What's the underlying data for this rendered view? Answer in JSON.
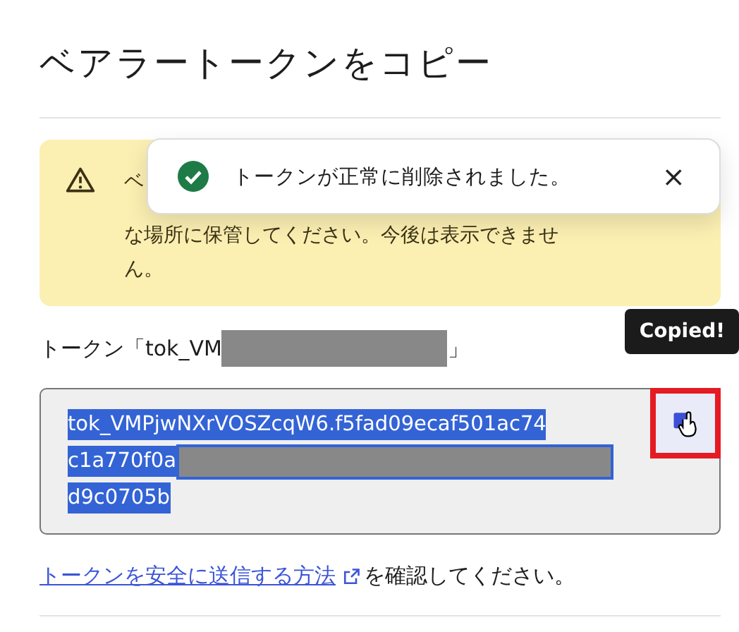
{
  "title": "ベアラートークンをコピー",
  "warning": {
    "lines": [
      "ベ",
      "な場所に保管してください。今後は表示できませ",
      "ん。"
    ]
  },
  "toast": {
    "message": "トークンが正常に削除されました。",
    "close": "×"
  },
  "token_label": {
    "prefix": "トークン「tok_VM",
    "suffix": "」"
  },
  "token": {
    "lines": [
      {
        "text": "tok_VMPjwNXrVOSZcqW6.f5fad09ecaf501ac74",
        "redacted": false
      },
      {
        "text": "c1a770f0a",
        "redacted": true
      },
      {
        "text": "d9c0705b",
        "redacted": false
      }
    ],
    "selected": true
  },
  "copy_button": {
    "tooltip": "Copied!",
    "highlighted": true
  },
  "footer": {
    "link": "トークンを安全に送信する方法",
    "text": "を確認してください。"
  }
}
